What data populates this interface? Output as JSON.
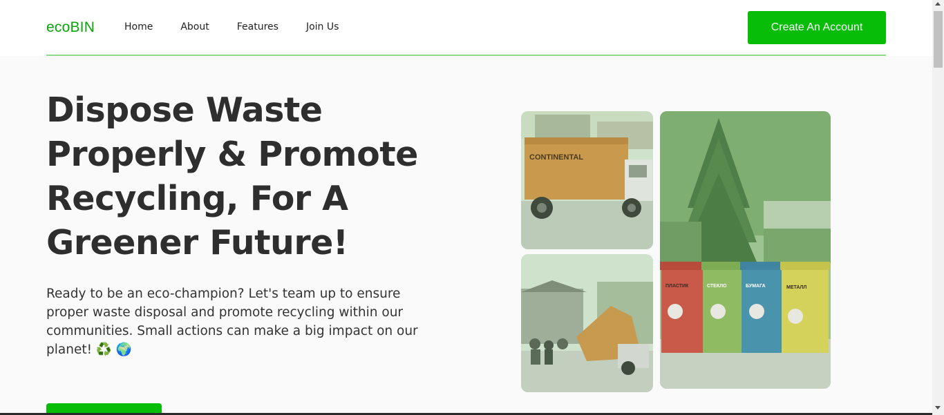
{
  "brand": {
    "logo": "ecoBIN",
    "accent": "#07bd07"
  },
  "nav": {
    "links": [
      "Home",
      "About",
      "Features",
      "Join Us"
    ],
    "cta_label": "Create An Account"
  },
  "hero": {
    "title_lines": [
      "Dispose Waste",
      "Properly & Promote",
      "Recycling, For A",
      "Greener Future!"
    ],
    "description": "Ready to be an eco-champion? Let's team up to ensure proper waste disposal and promote recycling within our communities. Small actions can make a big impact on our planet! ♻️ 🌍",
    "button_label": ""
  },
  "images": {
    "truck": {
      "text": "CONTINENTAL"
    },
    "bins": {
      "labels": [
        "ПЛАСТИК",
        "СТЕКЛО",
        "БУМАГА",
        "МЕТАЛЛ"
      ]
    }
  }
}
